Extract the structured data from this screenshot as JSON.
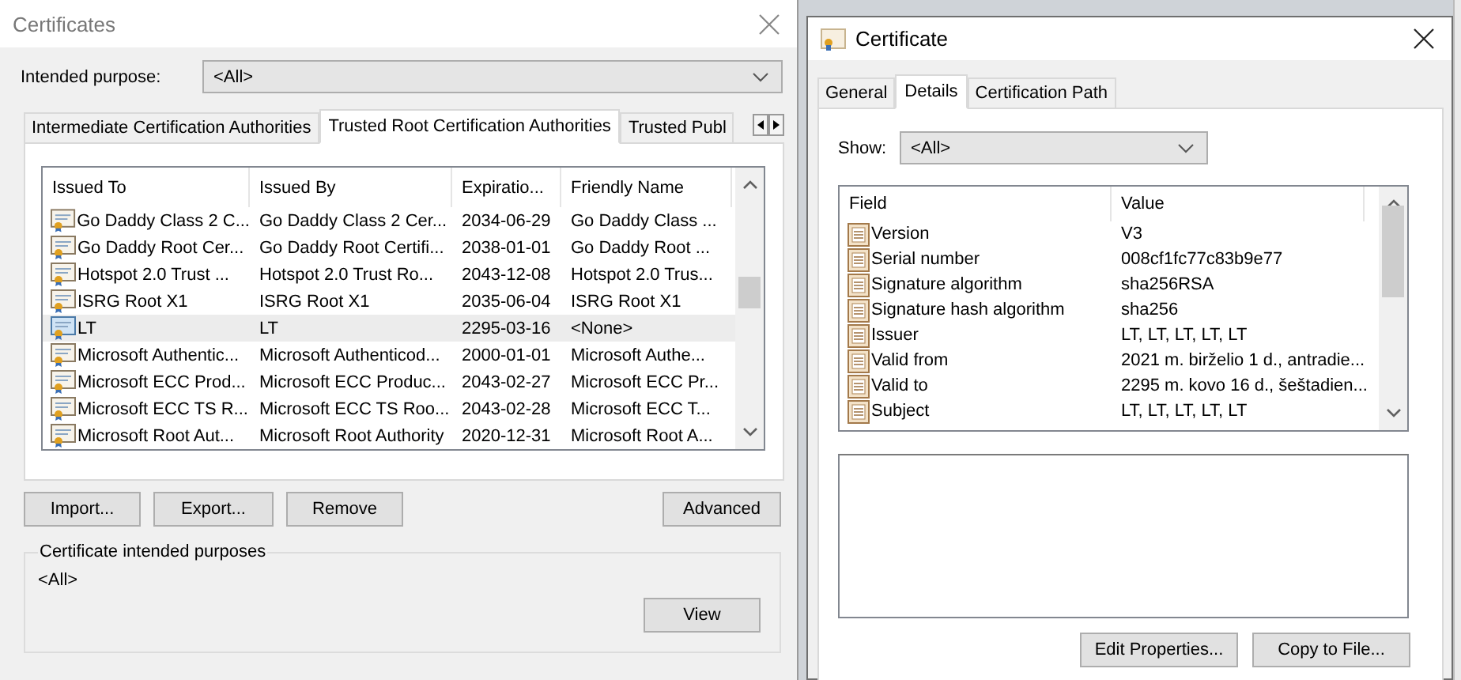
{
  "certificates_window": {
    "title": "Certificates",
    "intended_purpose": {
      "label": "Intended purpose:",
      "value": "<All>"
    },
    "tabs": [
      {
        "label": "Intermediate Certification Authorities",
        "selected": false
      },
      {
        "label": "Trusted Root Certification Authorities",
        "selected": true
      },
      {
        "label": "Trusted Publ",
        "selected": false
      }
    ],
    "table": {
      "columns": [
        "Issued To",
        "Issued By",
        "Expiratio...",
        "Friendly Name"
      ],
      "rows": [
        {
          "cells": [
            "Go Daddy Class 2 C...",
            "Go Daddy Class 2 Cer...",
            "2034-06-29",
            "Go Daddy Class ..."
          ],
          "selected": false
        },
        {
          "cells": [
            "Go Daddy Root Cer...",
            "Go Daddy Root Certifi...",
            "2038-01-01",
            "Go Daddy Root ..."
          ],
          "selected": false
        },
        {
          "cells": [
            "Hotspot 2.0 Trust ...",
            "Hotspot 2.0 Trust Ro...",
            "2043-12-08",
            "Hotspot 2.0 Trus..."
          ],
          "selected": false
        },
        {
          "cells": [
            "ISRG Root X1",
            "ISRG Root X1",
            "2035-06-04",
            "ISRG Root X1"
          ],
          "selected": false
        },
        {
          "cells": [
            "LT",
            "LT",
            "2295-03-16",
            "<None>"
          ],
          "selected": true
        },
        {
          "cells": [
            "Microsoft Authentic...",
            "Microsoft Authenticod...",
            "2000-01-01",
            "Microsoft Authe..."
          ],
          "selected": false
        },
        {
          "cells": [
            "Microsoft ECC Prod...",
            "Microsoft ECC Produc...",
            "2043-02-27",
            "Microsoft ECC Pr..."
          ],
          "selected": false
        },
        {
          "cells": [
            "Microsoft ECC TS R...",
            "Microsoft ECC TS Roo...",
            "2043-02-28",
            "Microsoft ECC T..."
          ],
          "selected": false
        },
        {
          "cells": [
            "Microsoft Root Aut...",
            "Microsoft Root Authority",
            "2020-12-31",
            "Microsoft Root A..."
          ],
          "selected": false
        }
      ]
    },
    "buttons": [
      "Import...",
      "Export...",
      "Remove"
    ],
    "advanced_button": "Advanced",
    "purposes_group": {
      "title": "Certificate intended purposes",
      "value": "<All>",
      "button": "View"
    }
  },
  "certificate_window": {
    "title": "Certificate",
    "tabs": [
      {
        "label": "General",
        "selected": false
      },
      {
        "label": "Details",
        "selected": true
      },
      {
        "label": "Certification Path",
        "selected": false
      }
    ],
    "show": {
      "label": "Show:",
      "value": "<All>"
    },
    "table": {
      "columns": [
        "Field",
        "Value"
      ],
      "rows": [
        {
          "field": "Version",
          "value": "V3"
        },
        {
          "field": "Serial number",
          "value": "008cf1fc77c83b9e77"
        },
        {
          "field": "Signature algorithm",
          "value": "sha256RSA"
        },
        {
          "field": "Signature hash algorithm",
          "value": "sha256"
        },
        {
          "field": "Issuer",
          "value": "LT, LT, LT, LT, LT"
        },
        {
          "field": "Valid from",
          "value": "2021 m. birželio 1 d., antradie..."
        },
        {
          "field": "Valid to",
          "value": "2295 m. kovo 16 d., šeštadien..."
        },
        {
          "field": "Subject",
          "value": "LT, LT, LT, LT, LT"
        }
      ]
    },
    "buttons": [
      "Edit Properties...",
      "Copy to File..."
    ]
  }
}
